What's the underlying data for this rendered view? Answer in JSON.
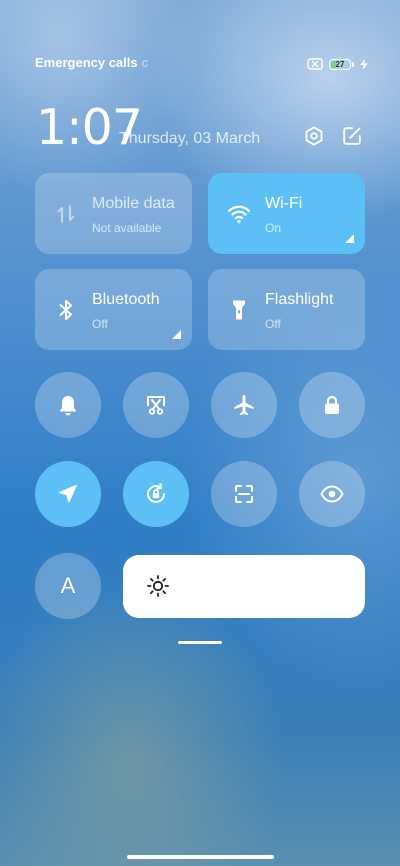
{
  "status_bar": {
    "left_text": "Emergency calls",
    "left_text_faded": "c",
    "battery_level": "27",
    "battery_fraction": 0.27,
    "battery_fill_color": "#7ad77a",
    "icons": [
      "sim-off-icon",
      "battery-icon",
      "charging-bolt-icon"
    ]
  },
  "header": {
    "time": "1:07",
    "date": "Thursday, 03 March",
    "icons": [
      "settings-hexagon-icon",
      "edit-icon"
    ]
  },
  "tiles": [
    {
      "title": "Mobile data",
      "subtitle": "Not available",
      "icon": "mobile-data-icon",
      "state": "disabled"
    },
    {
      "title": "Wi-Fi",
      "subtitle": "On",
      "icon": "wifi-icon",
      "state": "on"
    },
    {
      "title": "Bluetooth",
      "subtitle": "Off",
      "icon": "bluetooth-icon",
      "state": "off"
    },
    {
      "title": "Flashlight",
      "subtitle": "Off",
      "icon": "flashlight-icon",
      "state": "off"
    }
  ],
  "toggles_row1": [
    {
      "icon": "bell-icon",
      "state": "off"
    },
    {
      "icon": "screenshot-icon",
      "state": "off"
    },
    {
      "icon": "airplane-icon",
      "state": "off"
    },
    {
      "icon": "lock-icon",
      "state": "off"
    }
  ],
  "toggles_row2": [
    {
      "icon": "location-icon",
      "state": "on"
    },
    {
      "icon": "rotation-lock-icon",
      "state": "on"
    },
    {
      "icon": "scanner-icon",
      "state": "off"
    },
    {
      "icon": "eye-icon",
      "state": "off"
    }
  ],
  "auto_brightness": {
    "label": "A",
    "state": "off"
  },
  "brightness": {
    "level": 1.0,
    "icon": "sun-icon"
  },
  "colors": {
    "accent": "#5cc0f6",
    "tile_inactive": "rgba(255,255,255,0.22)",
    "text": "#ffffff"
  }
}
